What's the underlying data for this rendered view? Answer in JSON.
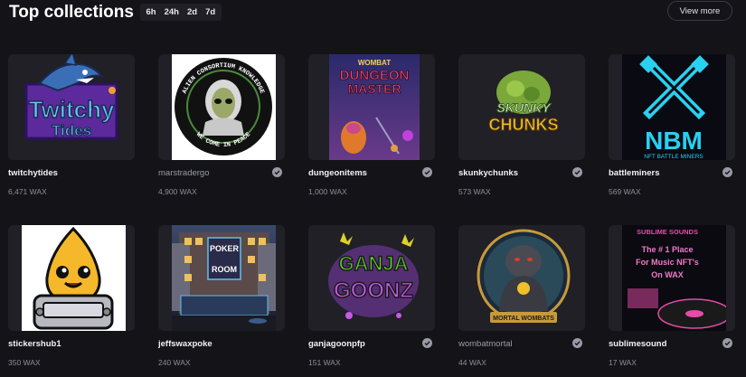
{
  "header": {
    "title": "Top collections",
    "tabs": [
      "6h",
      "24h",
      "2d",
      "7d"
    ],
    "view_more": "View more"
  },
  "collections": [
    {
      "name": "twitchytides",
      "volume": "6,471 WAX",
      "verified": false,
      "dim": false,
      "icon": "twitchy-tides-shark-logo"
    },
    {
      "name": "marstradergo",
      "volume": "4,900 WAX",
      "verified": true,
      "dim": true,
      "icon": "alien-consortium-knowledge-badge",
      "badge_top": "ALIEN CONSORTIUM KNOWLEDGE",
      "badge_bottom": "WE COME IN PEACE"
    },
    {
      "name": "dungeonitems",
      "volume": "1,000 WAX",
      "verified": true,
      "dim": false,
      "icon": "wombat-dungeon-master-art",
      "art_text_1": "WOMBAT",
      "art_text_2": "DUNGEON",
      "art_text_3": "MASTER"
    },
    {
      "name": "skunkychunks",
      "volume": "573 WAX",
      "verified": true,
      "dim": false,
      "icon": "skunky-chunks-logo",
      "art_text_1": "SKUNKY",
      "art_text_2": "CHUNKS"
    },
    {
      "name": "battleminers",
      "volume": "569 WAX",
      "verified": true,
      "dim": false,
      "icon": "nbm-battle-miners-logo",
      "art_text_1": "NBM",
      "art_text_2": "NFT BATTLE MINERS"
    },
    {
      "name": "stickershub1",
      "volume": "350 WAX",
      "verified": false,
      "dim": false,
      "icon": "sticker-robot-drop-mascot"
    },
    {
      "name": "jeffswaxpoke",
      "volume": "240 WAX",
      "verified": false,
      "dim": false,
      "icon": "poker-room-building",
      "art_text_1": "POKER",
      "art_text_2": "ROOM"
    },
    {
      "name": "ganjagoonpfp",
      "volume": "151 WAX",
      "verified": true,
      "dim": false,
      "icon": "ganja-goonz-graffiti-logo",
      "art_text_1": "GANJA",
      "art_text_2": "GOONZ"
    },
    {
      "name": "wombatmortal",
      "volume": "44 WAX",
      "verified": true,
      "dim": true,
      "icon": "mortal-wombats-emblem",
      "art_text_1": "MORTAL WOMBATS"
    },
    {
      "name": "sublimesound",
      "volume": "17 WAX",
      "verified": true,
      "dim": false,
      "icon": "sublime-sounds-vinyl",
      "art_text_1": "SUBLIME SOUNDS",
      "art_text_2": "The # 1 Place",
      "art_text_3": "For Music NFT's",
      "art_text_4": "On WAX"
    }
  ],
  "colors": {
    "background": "#141418",
    "card": "#202026",
    "muted": "#8c8c96"
  }
}
